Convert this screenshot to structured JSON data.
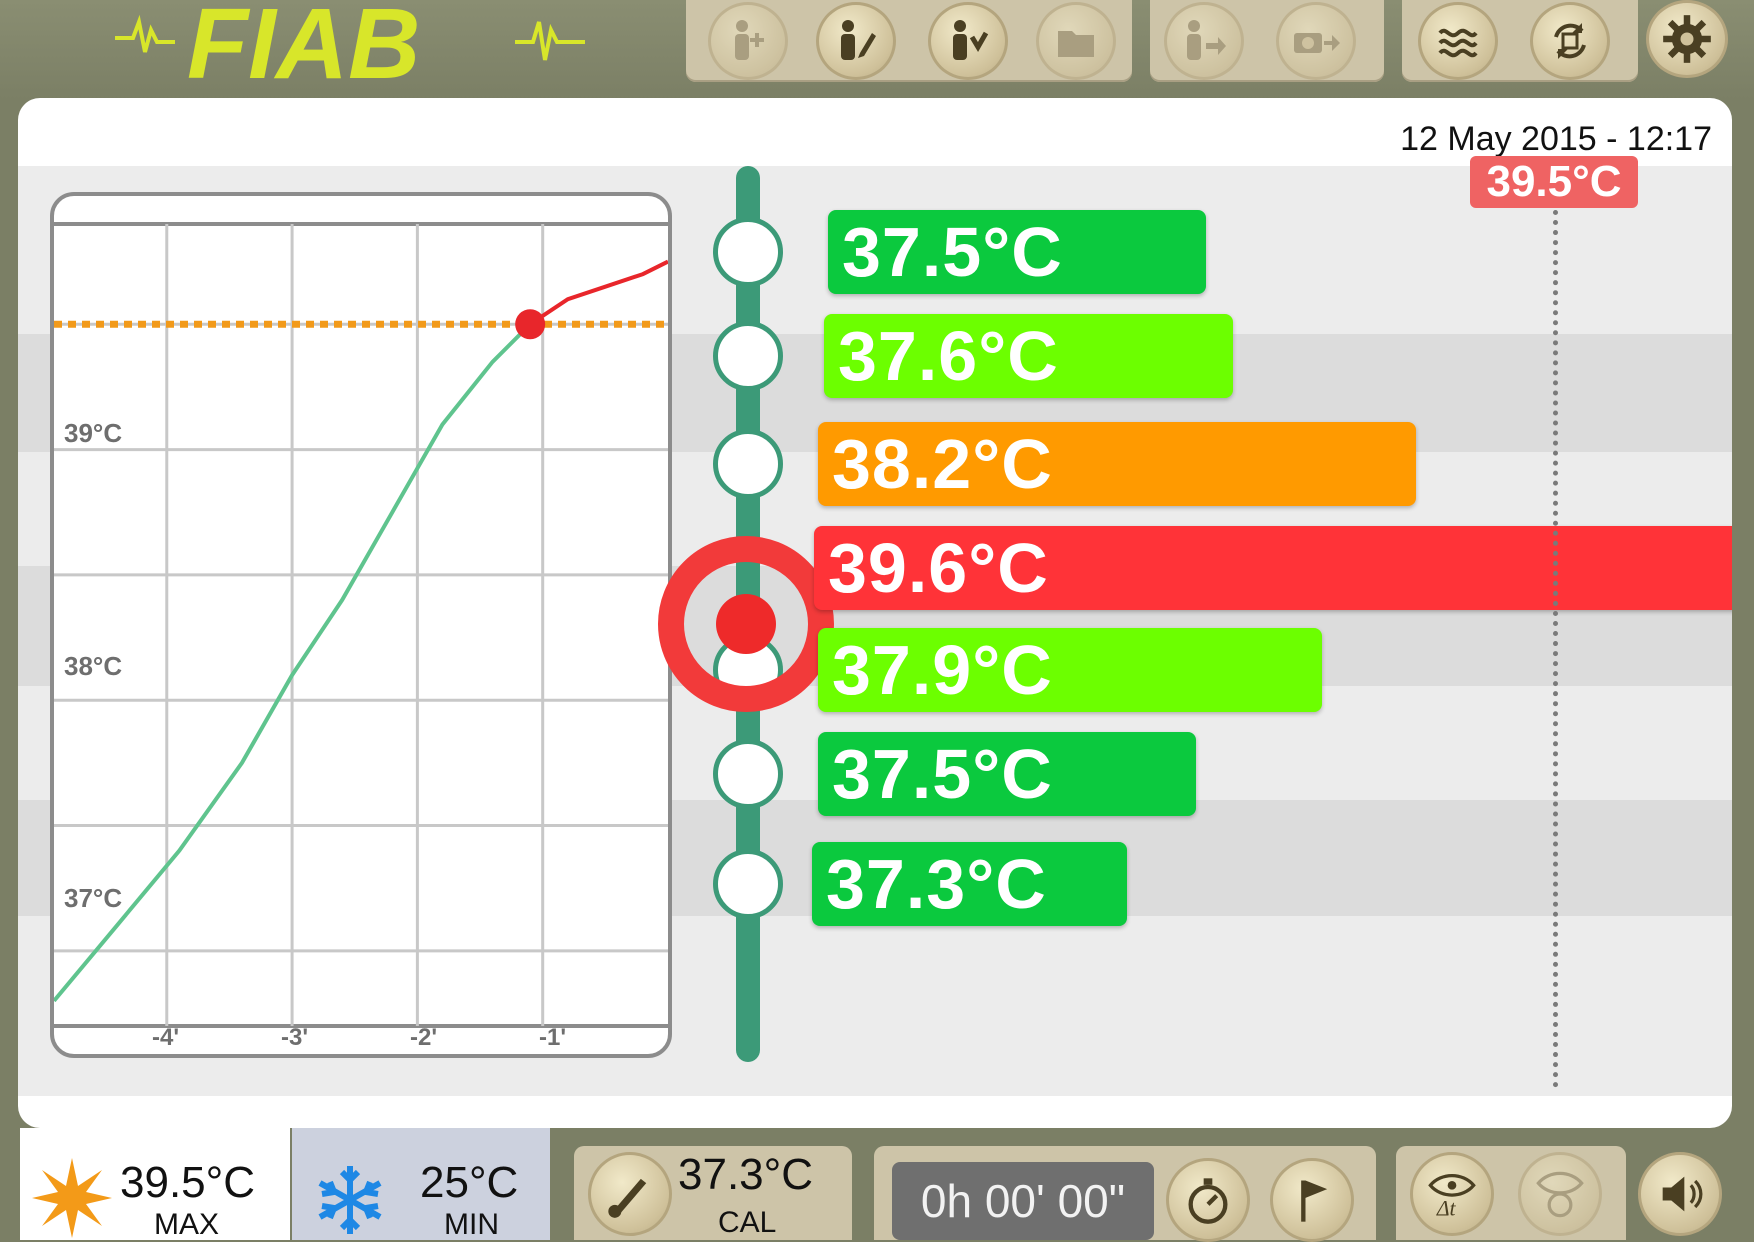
{
  "app": {
    "logo_text": "FIAB"
  },
  "header": {
    "datetime": "12 May 2015 - 12:17"
  },
  "toolbar": {
    "buttons": [
      {
        "name": "add-patient-icon",
        "dim": true
      },
      {
        "name": "edit-patient-icon",
        "dim": false
      },
      {
        "name": "select-patient-icon",
        "dim": false
      },
      {
        "name": "folder-icon",
        "dim": true
      },
      {
        "name": "export-patient-icon",
        "dim": true
      },
      {
        "name": "export-photo-icon",
        "dim": true
      },
      {
        "name": "waves-icon",
        "dim": false
      },
      {
        "name": "rotate-icon",
        "dim": false
      },
      {
        "name": "gear-icon",
        "dim": false
      }
    ]
  },
  "chart_data": {
    "type": "line",
    "ylim": [
      36.7,
      39.9
    ],
    "xlim": [
      -4.9,
      0
    ],
    "yticks": [
      "39°C",
      "38°C",
      "37°C"
    ],
    "xticks": [
      "-4'",
      "-3'",
      "-2'",
      "-1'"
    ],
    "threshold": 39.5,
    "series": [
      {
        "color": "#5fc48e",
        "x": [
          -4.9,
          -4.4,
          -3.9,
          -3.4,
          -3.0,
          -2.6,
          -2.2,
          -1.8,
          -1.4,
          -1.1
        ],
        "y": [
          36.8,
          37.1,
          37.4,
          37.75,
          38.1,
          38.4,
          38.75,
          39.1,
          39.35,
          39.5
        ]
      },
      {
        "color": "#e8262b",
        "x": [
          -1.1,
          -0.8,
          -0.5,
          -0.2,
          0
        ],
        "y": [
          39.5,
          39.6,
          39.65,
          39.7,
          39.75
        ]
      }
    ],
    "marker": {
      "x": -1.1,
      "y": 39.5
    }
  },
  "channels": [
    {
      "value": "37.5°C",
      "temp": 37.5,
      "color": "#0bc93e",
      "alarm": false
    },
    {
      "value": "37.6°C",
      "temp": 37.6,
      "color": "#6cff00",
      "alarm": false
    },
    {
      "value": "38.2°C",
      "temp": 38.2,
      "color": "#ff9a00",
      "alarm": false
    },
    {
      "value": "39.6°C",
      "temp": 39.6,
      "color": "#ff3338",
      "alarm": true
    },
    {
      "value": "37.9°C",
      "temp": 37.9,
      "color": "#6cff00",
      "alarm": false
    },
    {
      "value": "37.5°C",
      "temp": 37.5,
      "color": "#0bc93e",
      "alarm": false
    },
    {
      "value": "37.3°C",
      "temp": 37.3,
      "color": "#0bc93e",
      "alarm": false
    }
  ],
  "threshold_label": "39.5°C",
  "bottombar": {
    "max": {
      "value": "39.5°C",
      "label": "MAX"
    },
    "min": {
      "value": "25°C",
      "label": "MIN"
    },
    "cal": {
      "value": "37.3°C",
      "label": "CAL"
    },
    "timer": "0h 00' 00\""
  }
}
